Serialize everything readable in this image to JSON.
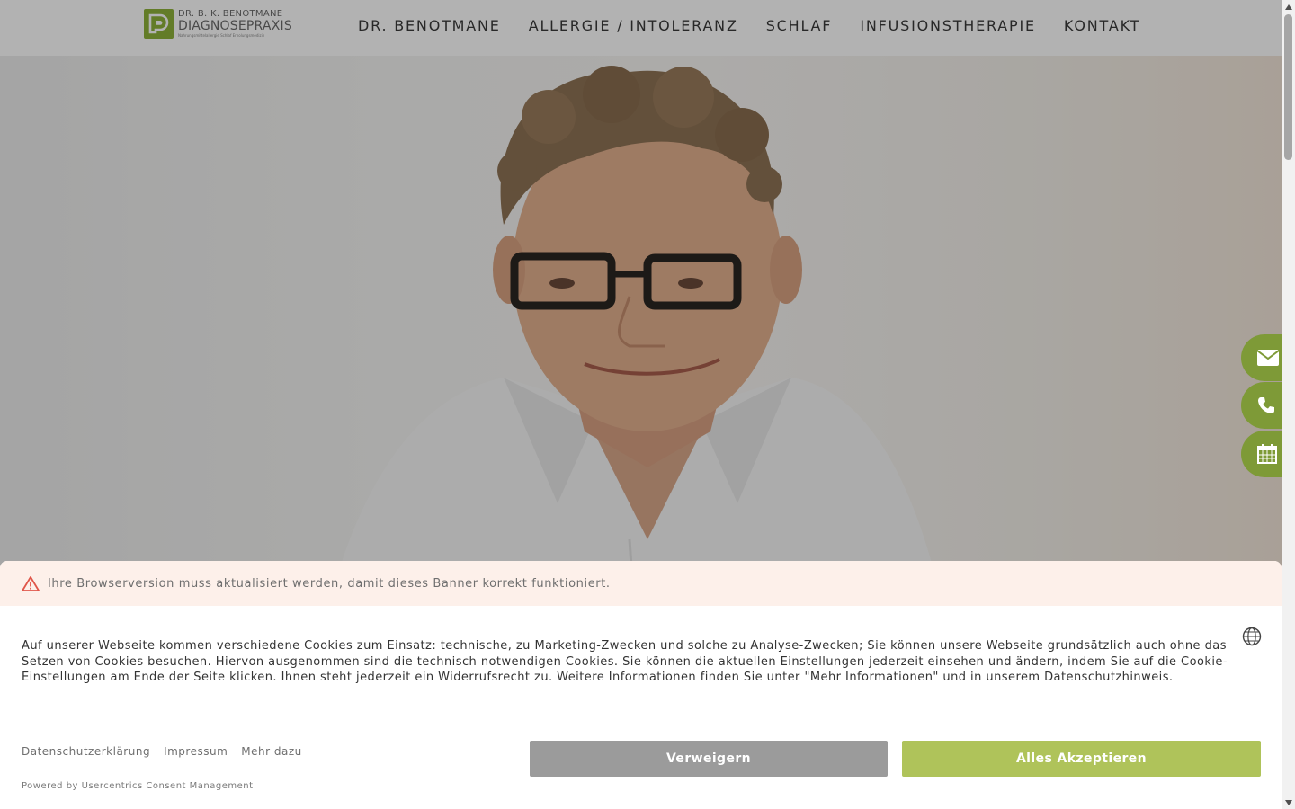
{
  "header": {
    "logo": {
      "line1": "DR. B. K. BENOTMANE",
      "line2": "DIAGNOSEPRAXIS",
      "line3": "Nahrungsmittelallergie  Schlaf  Erholungsmedizin"
    },
    "nav": [
      {
        "label": "DR. BENOTMANE"
      },
      {
        "label": "ALLERGIE / INTOLERANZ"
      },
      {
        "label": "SCHLAF"
      },
      {
        "label": "INFUSIONSTHERAPIE"
      },
      {
        "label": "KONTAKT"
      }
    ]
  },
  "floating_actions": [
    {
      "icon": "email-icon"
    },
    {
      "icon": "phone-icon"
    },
    {
      "icon": "calendar-icon"
    }
  ],
  "cookie_banner": {
    "warning": "Ihre Browserversion muss aktualisiert werden, damit dieses Banner korrekt funktioniert.",
    "text": "Auf unserer Webseite kommen verschiedene Cookies zum Einsatz: technische, zu Marketing-Zwecken und solche zu Analyse-Zwecken; Sie können unsere Webseite grundsätzlich auch ohne das Setzen von Cookies besuchen. Hiervon ausgenommen sind die technisch notwendigen Cookies. Sie können die aktuellen Einstellungen jederzeit einsehen und ändern, indem Sie auf die Cookie-Einstellungen am Ende der Seite klicken. Ihnen steht jederzeit ein Widerrufsrecht zu. Weitere Informationen finden Sie unter \"Mehr Informationen\" und in unserem Datenschutzhinweis.",
    "links": [
      {
        "label": "Datenschutzerklärung"
      },
      {
        "label": "Impressum"
      },
      {
        "label": "Mehr dazu"
      }
    ],
    "powered_by": "Powered by Usercentrics Consent Management",
    "deny_label": "Verweigern",
    "accept_label": "Alles Akzeptieren"
  },
  "colors": {
    "brand_green": "#8fb23a",
    "accept_green": "#afc35a",
    "deny_gray": "#9b9b9b",
    "warning_bg": "#fdf0ea",
    "warning_icon": "#e0564a"
  }
}
